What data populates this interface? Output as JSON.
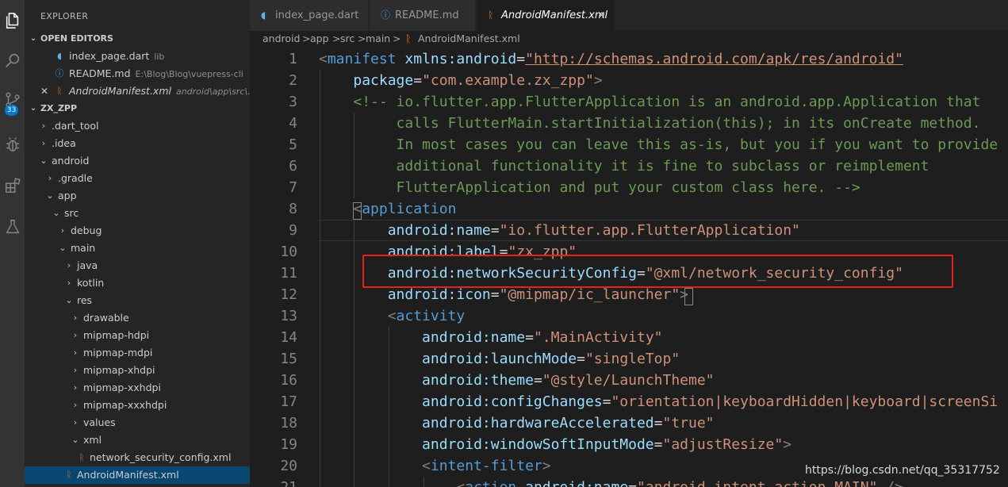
{
  "activity_bar": {
    "icons": [
      "files-icon",
      "search-icon",
      "source-control-icon",
      "debug-icon",
      "extensions-icon",
      "testing-icon"
    ],
    "badge": "33"
  },
  "sidebar": {
    "title": "EXPLORER",
    "open_editors": {
      "header": "OPEN EDITORS",
      "items": [
        {
          "name": "index_page.dart",
          "desc": "lib"
        },
        {
          "name": "README.md",
          "desc": "E:\\Blog\\Blog\\vuepress-cli"
        },
        {
          "name": "AndroidManifest.xml",
          "desc": "android\\app\\src\\..."
        }
      ]
    },
    "project": {
      "header": "ZX_ZPP",
      "tree": [
        ".dart_tool",
        ".idea",
        "android",
        ".gradle",
        "app",
        "src",
        "debug",
        "main",
        "java",
        "kotlin",
        "res",
        "drawable",
        "mipmap-hdpi",
        "mipmap-mdpi",
        "mipmap-xhdpi",
        "mipmap-xxhdpi",
        "mipmap-xxxhdpi",
        "values",
        "xml",
        "network_security_config.xml",
        "AndroidManifest.xml"
      ]
    }
  },
  "tabs": [
    {
      "label": "index_page.dart",
      "close": ""
    },
    {
      "label": "README.md",
      "close": ""
    },
    {
      "label": "AndroidManifest.xml",
      "close": "×"
    }
  ],
  "breadcrumb": [
    "android",
    "app",
    "src",
    "main",
    "AndroidManifest.xml"
  ],
  "separator": ">",
  "editor": {
    "line_numbers": [
      "1",
      "2",
      "3",
      "4",
      "5",
      "6",
      "7",
      "8",
      "9",
      "10",
      "11",
      "12",
      "13",
      "14",
      "15",
      "16",
      "17",
      "18",
      "19",
      "20",
      "21"
    ],
    "code": {
      "l1": {
        "tag": "manifest",
        "attr": "xmlns:android",
        "val": "\"http://schemas.android.com/apk/res/android\""
      },
      "l2": {
        "attr": "package",
        "val": "\"com.example.zx_zpp\""
      },
      "l3": "<!-- io.flutter.app.FlutterApplication is an android.app.Application that",
      "l4": "calls FlutterMain.startInitialization(this); in its onCreate method.",
      "l5": "In most cases you can leave this as-is, but you if you want to provide",
      "l6": "additional functionality it is fine to subclass or reimplement",
      "l7": "FlutterApplication and put your custom class here. -->",
      "l8": {
        "tag": "application"
      },
      "l9": {
        "attr": "android:name",
        "val": "\"io.flutter.app.FlutterApplication\""
      },
      "l10": {
        "attr": "android:label",
        "val": "\"zx_zpp\""
      },
      "l11": {
        "attr": "android:networkSecurityConfig",
        "val": "\"@xml/network_security_config\""
      },
      "l12": {
        "attr": "android:icon",
        "val": "\"@mipmap/ic_launcher\""
      },
      "l13": {
        "tag": "activity"
      },
      "l14": {
        "attr": "android:name",
        "val": "\".MainActivity\""
      },
      "l15": {
        "attr": "android:launchMode",
        "val": "\"singleTop\""
      },
      "l16": {
        "attr": "android:theme",
        "val": "\"@style/LaunchTheme\""
      },
      "l17": {
        "attr": "android:configChanges",
        "val": "\"orientation|keyboardHidden|keyboard|screenSi"
      },
      "l18": {
        "attr": "android:hardwareAccelerated",
        "val": "\"true\""
      },
      "l19": {
        "attr": "android:windowSoftInputMode",
        "val": "\"adjustResize\""
      },
      "l20": {
        "tag": "intent-filter"
      },
      "l21": {
        "tag": "action",
        "attr": "android:name",
        "val": "\"android.intent.action.MAIN\""
      }
    }
  },
  "watermark": "https://blog.csdn.net/qq_35317752",
  "colors": {
    "accent": "#007acc",
    "annotation": "#e5231b",
    "selection": "#094771"
  }
}
